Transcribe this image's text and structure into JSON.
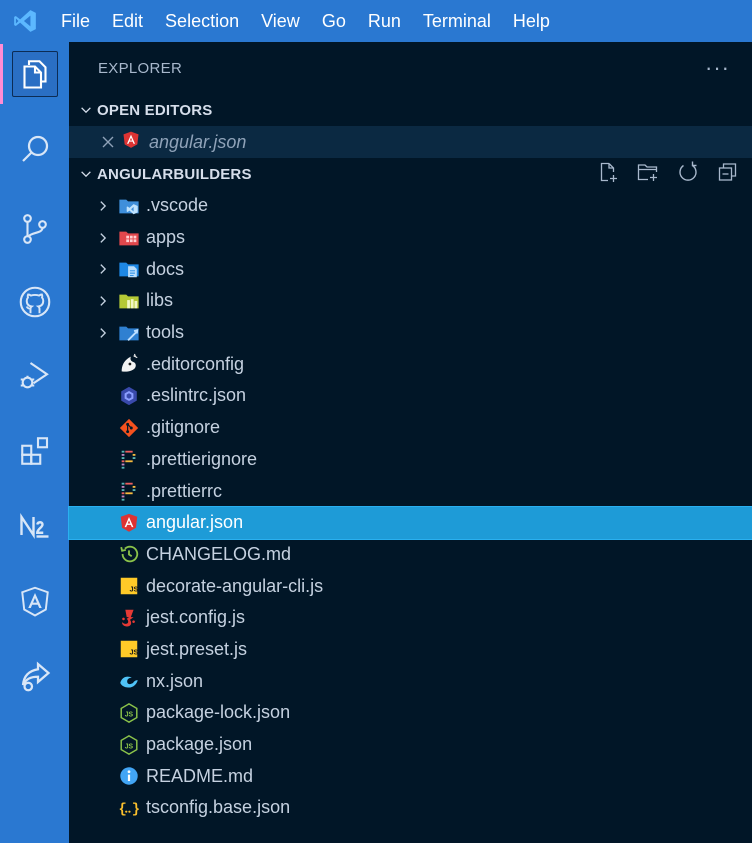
{
  "menubar": {
    "items": [
      "File",
      "Edit",
      "Selection",
      "View",
      "Go",
      "Run",
      "Terminal",
      "Help"
    ]
  },
  "activitybar": {
    "items": [
      "explorer-icon",
      "search-icon",
      "source-control-icon",
      "github-icon",
      "run-debug-icon",
      "extensions-icon",
      "nx-console-icon",
      "angular-icon",
      "live-share-icon"
    ]
  },
  "sidebar": {
    "title": "EXPLORER",
    "more": "···",
    "open_editors": {
      "header": "OPEN EDITORS",
      "files": [
        {
          "name": "angular.json",
          "icon": "angular-icon"
        }
      ]
    },
    "workspace": {
      "header": "ANGULARBUILDERS",
      "folders": [
        {
          "name": ".vscode",
          "icon": "vscode-folder-icon"
        },
        {
          "name": "apps",
          "icon": "apps-folder-icon"
        },
        {
          "name": "docs",
          "icon": "docs-folder-icon"
        },
        {
          "name": "libs",
          "icon": "libs-folder-icon"
        },
        {
          "name": "tools",
          "icon": "tools-folder-icon"
        }
      ],
      "files": [
        {
          "name": ".editorconfig",
          "icon": "editorconfig-icon"
        },
        {
          "name": ".eslintrc.json",
          "icon": "eslint-icon"
        },
        {
          "name": ".gitignore",
          "icon": "git-icon"
        },
        {
          "name": ".prettierignore",
          "icon": "prettier-icon"
        },
        {
          "name": ".prettierrc",
          "icon": "prettier-icon"
        },
        {
          "name": "angular.json",
          "icon": "angular-icon",
          "selected": true
        },
        {
          "name": "CHANGELOG.md",
          "icon": "changelog-icon"
        },
        {
          "name": "decorate-angular-cli.js",
          "icon": "js-icon"
        },
        {
          "name": "jest.config.js",
          "icon": "jest-icon"
        },
        {
          "name": "jest.preset.js",
          "icon": "js-icon"
        },
        {
          "name": "nx.json",
          "icon": "nx-icon"
        },
        {
          "name": "package-lock.json",
          "icon": "nodejs-icon"
        },
        {
          "name": "package.json",
          "icon": "nodejs-icon"
        },
        {
          "name": "README.md",
          "icon": "info-icon"
        },
        {
          "name": "tsconfig.base.json",
          "icon": "json-icon"
        }
      ]
    }
  },
  "colors": {
    "accent": "#2a78d1",
    "sidebar_bg": "#011627",
    "selection": "#1e9bd7",
    "active_indicator": "#ff8cd4"
  }
}
